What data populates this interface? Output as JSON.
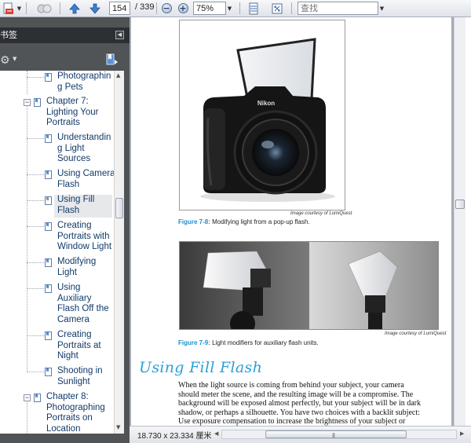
{
  "toolbar": {
    "current_page": "154",
    "total_pages": "/ 339",
    "zoom": "75%",
    "search_placeholder": "查找"
  },
  "sidebar": {
    "panel_title": "书签",
    "bookmarks": [
      {
        "label": "Photographin\ng Pets",
        "level": 1
      },
      {
        "label": "Chapter 7:\nLighting Your\nPortraits",
        "level": 0,
        "expanded": true
      },
      {
        "label": "Understandin\ng Light\nSources",
        "level": 1
      },
      {
        "label": "Using Camera\nFlash",
        "level": 1
      },
      {
        "label": "Using Fill\nFlash",
        "level": 1,
        "selected": true
      },
      {
        "label": "Creating\nPortraits with\nWindow Light",
        "level": 1
      },
      {
        "label": "Modifying\nLight",
        "level": 1
      },
      {
        "label": "Using\nAuxiliary\nFlash Off the\nCamera",
        "level": 1
      },
      {
        "label": "Creating\nPortraits at\nNight",
        "level": 1
      },
      {
        "label": "Shooting in\nSunlight",
        "level": 1
      },
      {
        "label": "Chapter 8:\nPhotographing\nPortraits on\nLocation",
        "level": 0,
        "expanded": true
      }
    ]
  },
  "document": {
    "figure1": {
      "credit": "Image courtesy of LumiQuest",
      "number": "Figure 7-8:",
      "caption": " Modifying light from a pop-up flash.",
      "camera_brand": "Nikon"
    },
    "figure2": {
      "credit": "Image courtesy of LumiQuest",
      "number": "Figure 7-9:",
      "caption": " Light modifiers for auxiliary flash units."
    },
    "heading": "Using Fill Flash",
    "body_lines": [
      "When the light source is coming from behind your subject, your camera",
      "should meter the scene, and the resulting image will be a compromise. The",
      "background will be exposed almost perfectly, but your subject will be in dark",
      "shadow, or perhaps a silhouette. You have two choices with a backlit subject:",
      "Use exposure compensation to increase the brightness of your subject or"
    ]
  },
  "statusbar": {
    "page_size": "18.730 x 23.334 厘米"
  },
  "colors": {
    "accent_blue": "#2b9fd8",
    "sidebar_dark": "#505457",
    "tree_text": "#123a6a"
  }
}
